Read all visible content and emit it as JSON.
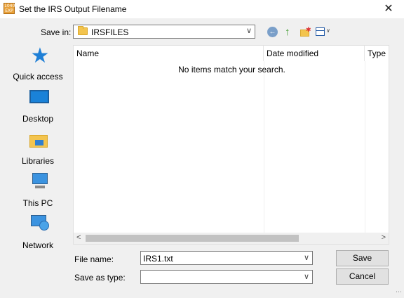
{
  "window": {
    "title": "Set the IRS Output Filename",
    "app_icon": "1040-exp-icon",
    "close_label": "✕"
  },
  "toolbar": {
    "save_in_label": "Save in:",
    "save_in_value": "IRSFILES",
    "icons": [
      "back-icon",
      "up-folder-icon",
      "new-folder-icon",
      "view-menu-icon"
    ]
  },
  "places": [
    {
      "label": "Quick access",
      "icon": "star-icon"
    },
    {
      "label": "Desktop",
      "icon": "desktop-icon"
    },
    {
      "label": "Libraries",
      "icon": "libraries-icon"
    },
    {
      "label": "This PC",
      "icon": "computer-icon"
    },
    {
      "label": "Network",
      "icon": "network-icon"
    }
  ],
  "file_list": {
    "columns": [
      "Name",
      "Date modified",
      "Type"
    ],
    "empty_message": "No items match your search.",
    "items": []
  },
  "form": {
    "file_name_label": "File name:",
    "file_name_value": "IRS1.txt",
    "save_as_type_label": "Save as type:",
    "save_as_type_value": ""
  },
  "buttons": {
    "save": "Save",
    "cancel": "Cancel"
  },
  "colors": {
    "accent": "#1e7fd6",
    "folder": "#f3c44e",
    "background": "#f0f0f0"
  }
}
